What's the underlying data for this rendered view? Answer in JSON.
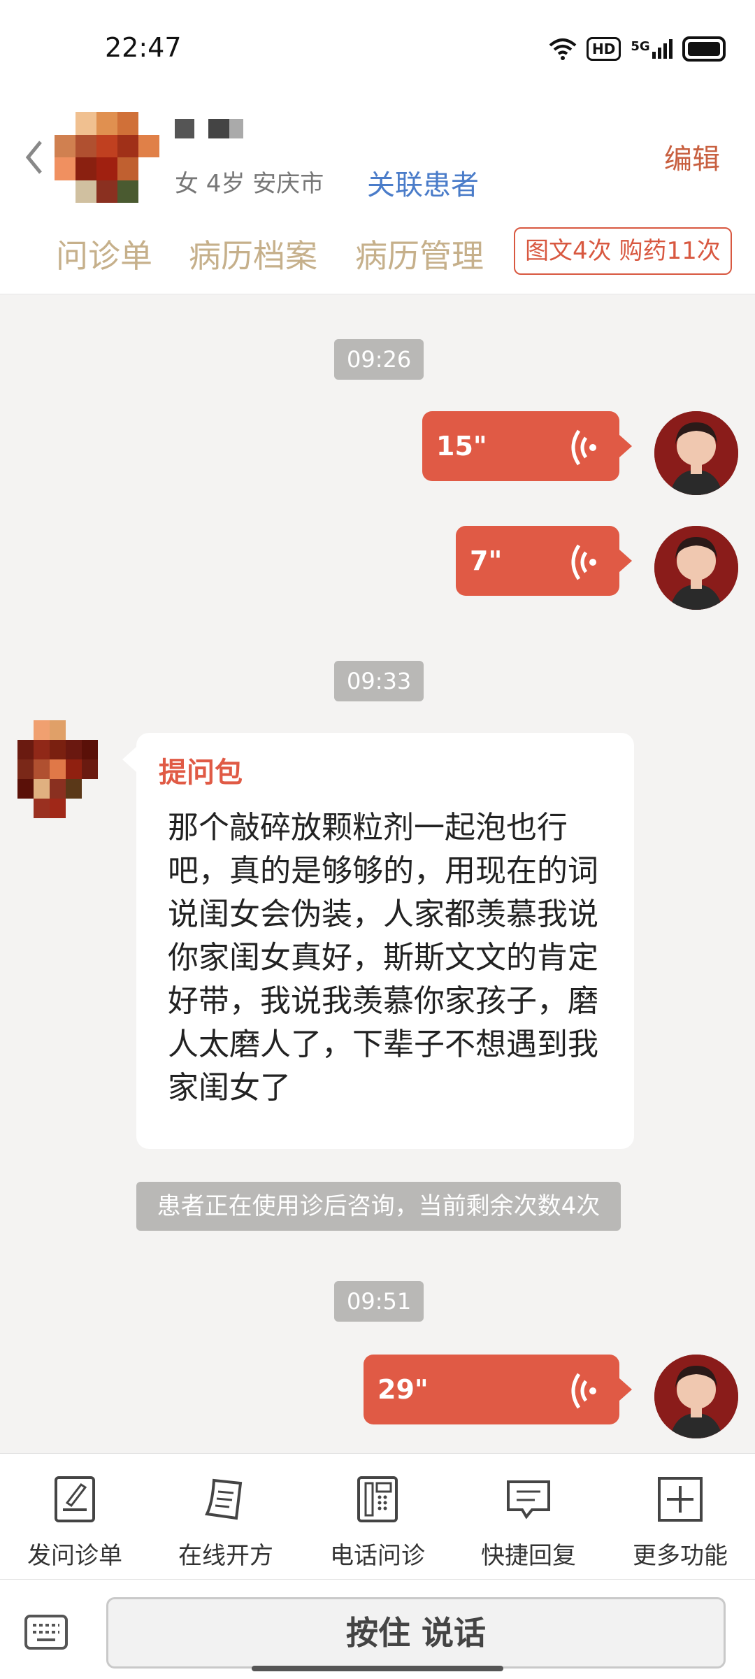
{
  "status_bar": {
    "time": "22:47",
    "hd": "HD",
    "network": "5G"
  },
  "header": {
    "patient_info": "女 4岁  安庆市",
    "link_patient": "关联患者",
    "edit": "编辑",
    "tabs": [
      "问诊单",
      "病历档案",
      "病历管理"
    ],
    "badge": "图文4次 购药11次"
  },
  "chat": {
    "times": [
      "09:26",
      "09:33",
      "09:51"
    ],
    "voice_messages": [
      {
        "duration": "15\""
      },
      {
        "duration": "7\""
      },
      {
        "duration": "29\""
      }
    ],
    "patient_message": {
      "tag": "提问包",
      "text": "那个敲碎放颗粒剂一起泡也行吧，真的是够够的，用现在的词说闺女会伪装，人家都羡慕我说你家闺女真好，斯斯文文的肯定好带，我说我羡慕你家孩子，磨人太磨人了，下辈子不想遇到我家闺女了"
    },
    "notice": "患者正在使用诊后咨询，当前剩余次数4次"
  },
  "toolbar": {
    "items": [
      {
        "label": "发问诊单",
        "icon": "form-icon"
      },
      {
        "label": "在线开方",
        "icon": "prescription-icon"
      },
      {
        "label": "电话问诊",
        "icon": "phone-icon"
      },
      {
        "label": "快捷回复",
        "icon": "quick-reply-icon"
      },
      {
        "label": "更多功能",
        "icon": "plus-icon"
      }
    ]
  },
  "input": {
    "talk_button": "按住 说话"
  },
  "colors": {
    "accent": "#e05a45",
    "tab": "#c6b08b",
    "link": "#4a7cc9"
  }
}
